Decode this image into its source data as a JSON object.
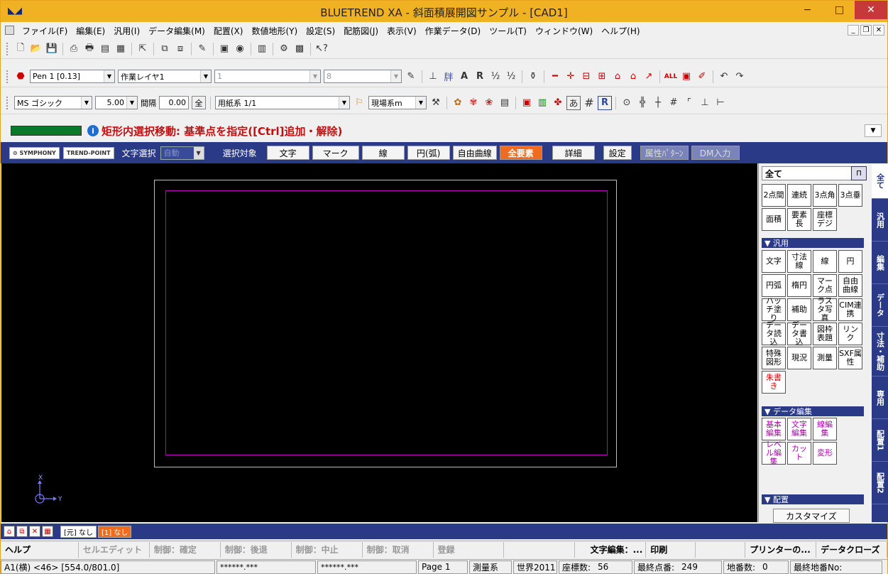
{
  "window": {
    "title": "BLUETREND XA - 斜面積展開図サンプル - [CAD1]",
    "min": "−",
    "max": "□",
    "close": "✕"
  },
  "menu": [
    "ファイル(F)",
    "編集(E)",
    "汎用(I)",
    "データ編集(M)",
    "配置(X)",
    "数値地形(Y)",
    "設定(S)",
    "配筋図(J)",
    "表示(V)",
    "作業データ(D)",
    "ツール(T)",
    "ウィンドウ(W)",
    "ヘルプ(H)"
  ],
  "mdi": {
    "min": "_",
    "restore": "❐",
    "close": "✕"
  },
  "toolbar2": {
    "pen": "Pen 1 [0.13]",
    "layer": "作業レイヤ1",
    "lineno": "1",
    "linestyle": "8",
    "text_a": "A",
    "text_r": "R",
    "frac": "½"
  },
  "toolbar3": {
    "font": "MS ゴシック",
    "size": "5.00",
    "spacing_label": "間隔",
    "spacing": "0.00",
    "all_btn": "全",
    "paper": "用紙系 1/1",
    "coord": "現場系m",
    "a_char": "あ",
    "r_char": "R"
  },
  "status_message": "矩形内選択移動: 基準点を指定([Ctrl]追加・解除)",
  "filterbar": {
    "logo1": "⊙ SYMPHONY",
    "logo2": "TREND-POINT",
    "text_select": "文字選択",
    "auto": "自動",
    "select_target": "選択対象",
    "buttons": [
      "文字",
      "マーク",
      "線",
      "円(弧)",
      "自由曲線",
      "全要素",
      "詳細",
      "設定",
      "属性ﾊﾟﾀｰﾝ",
      "DM入力"
    ],
    "active": "全要素"
  },
  "canvas": {
    "axis_x": "X",
    "axis_y": "Y"
  },
  "panel": {
    "header": "全て",
    "pin": "П",
    "measure": [
      "2点間",
      "連続",
      "3点角",
      "3点垂"
    ],
    "measure2": [
      "面積",
      "要素長",
      "座標デジ"
    ],
    "sec_general": "▼ 汎用",
    "general": [
      "文字",
      "寸法線",
      "線",
      "円",
      "円弧",
      "楕円",
      "マーク点",
      "自由曲線",
      "ハッチ塗り",
      "補助",
      "ラスタ写真",
      "CIM連携",
      "データ読込",
      "データ書込",
      "図枠表題",
      "リンク",
      "特殊図形",
      "現況",
      "測量",
      "SXF属性"
    ],
    "red_item": "朱書き",
    "sec_data_edit": "▼ データ編集",
    "data_edit": [
      "基本編集",
      "文字編集",
      "線編集",
      "レベル編集",
      "カット",
      "変形"
    ],
    "sec_layout": "▼ 配置",
    "customize": "カスタマイズ"
  },
  "vtabs": [
    "全て",
    "汎用",
    "編集",
    "データ",
    "寸法・補助",
    "専用",
    "配置1",
    "配置2"
  ],
  "layerbar": {
    "orig": "[元] なし",
    "cur": "[1] なし"
  },
  "fkeys": [
    "ヘルプ",
    "セルエディット",
    "制御：確定",
    "制御：後退",
    "制御：中止",
    "制御：取消",
    "登録",
    "",
    "文字編集：...",
    "印刷",
    "",
    "プリンターの...",
    "データクローズ"
  ],
  "statusbar": {
    "paper": "A1(横) <46> [554.0/801.0]",
    "c1": "******.***",
    "c2": "******.***",
    "page": "Page  1",
    "survey": "測量系",
    "world": "世界2011",
    "coord_count_label": "座標数:",
    "coord_count": "56",
    "last_point_label": "最終点番:",
    "last_point": "249",
    "lot_label": "地番数:",
    "lot": "0",
    "last_lot_label": "最終地番No:"
  }
}
